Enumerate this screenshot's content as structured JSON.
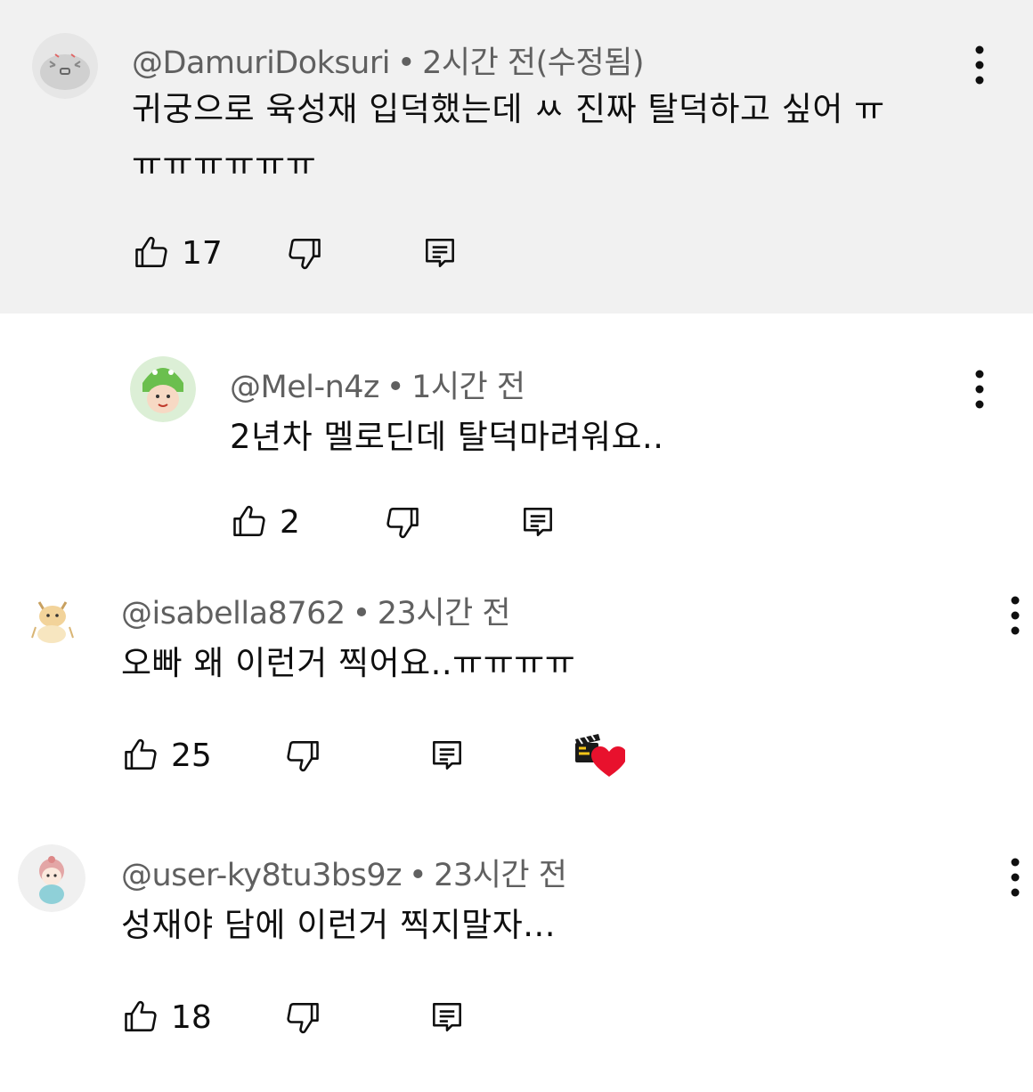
{
  "colors": {
    "highlight_bg": "#f1f1f1",
    "meta_text": "#606060",
    "text": "#0f0f0f",
    "heart": "#e8112d"
  },
  "comments": [
    {
      "handle": "@DamuriDoksuri",
      "time": "2시간 전(수정됨)",
      "lines": [
        "귀궁으로 육성재 입덕했는데 ㅆ 진짜 탈덕하고 싶어 ㅠ",
        "ㅠㅠㅠㅠㅠㅠ"
      ],
      "likes": "17",
      "avatar_icon": "gray-cat-avatar-icon",
      "highlighted": true
    },
    {
      "handle": "@Mel-n4z",
      "time": "1시간 전",
      "lines": [
        "2년차 멜로딘데 탈덕마려워요.."
      ],
      "likes": "2",
      "avatar_icon": "dino-kid-avatar-icon",
      "reply": true
    },
    {
      "handle": "@isabella8762",
      "time": "23시간 전",
      "lines": [
        "오빠 왜 이런거 찍어요..ㅠㅠㅠㅠ"
      ],
      "likes": "25",
      "avatar_icon": "cat-sketch-avatar-icon",
      "creator_heart": true,
      "creator_heart_icon": "creator-heart-icon"
    },
    {
      "handle": "@user-ky8tu3bs9z",
      "time": "23시간 전",
      "lines": [
        "성재야 담에 이런거 찍지말자..."
      ],
      "likes": "18",
      "avatar_icon": "plush-doll-avatar-icon"
    }
  ],
  "icons": {
    "like": "thumbs-up-icon",
    "dislike": "thumbs-down-icon",
    "reply": "reply-icon",
    "menu": "more-vert-icon"
  }
}
